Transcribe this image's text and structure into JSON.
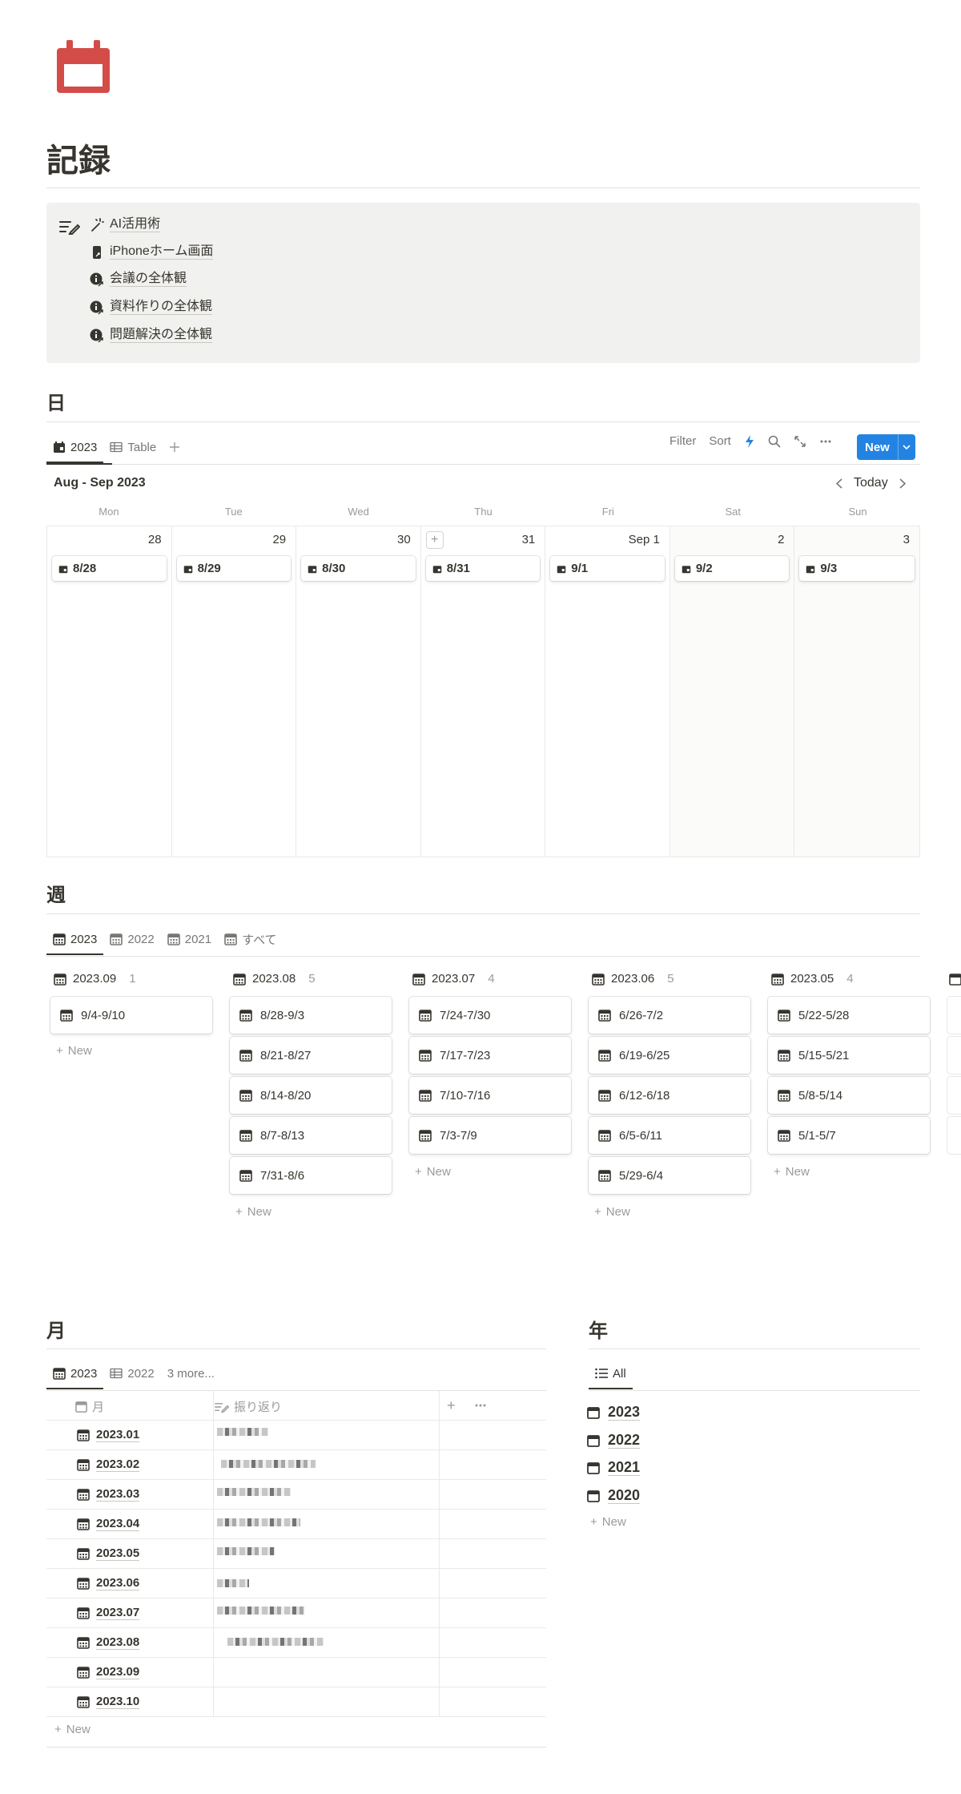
{
  "page": {
    "title": "記録",
    "icon": "calendar-icon",
    "icon_color": "#d44c47"
  },
  "callout": {
    "icon": "edit-list-icon",
    "items": [
      {
        "label": "AI活用術",
        "icon": "magic-wand-icon"
      },
      {
        "label": "iPhoneホーム画面",
        "icon": "phone-link-icon"
      },
      {
        "label": "会議の全体観",
        "icon": "info-link-icon"
      },
      {
        "label": "資料作りの全体観",
        "icon": "info-link-icon"
      },
      {
        "label": "問題解決の全体観",
        "icon": "info-link-icon"
      }
    ]
  },
  "day_section": {
    "heading": "日",
    "tabs": [
      {
        "label": "2023",
        "icon": "calendar-icon"
      },
      {
        "label": "Table",
        "icon": "table-icon"
      }
    ],
    "toolbar": {
      "filter": "Filter",
      "sort": "Sort",
      "new": "New"
    },
    "range_label": "Aug - Sep 2023",
    "today": "Today",
    "weekdays": [
      "Mon",
      "Tue",
      "Wed",
      "Thu",
      "Fri",
      "Sat",
      "Sun"
    ],
    "days": [
      {
        "num": "28",
        "card": "8/28"
      },
      {
        "num": "29",
        "card": "8/29"
      },
      {
        "num": "30",
        "card": "8/30"
      },
      {
        "num": "31",
        "card": "8/31"
      },
      {
        "num": "Sep 1",
        "card": "9/1"
      },
      {
        "num": "2",
        "card": "9/2"
      },
      {
        "num": "3",
        "card": "9/3"
      }
    ],
    "accent": "#2383e2"
  },
  "week_section": {
    "heading": "週",
    "tabs": [
      "2023",
      "2022",
      "2021",
      "すべて"
    ],
    "new_label": "New",
    "columns": [
      {
        "title": "2023.09",
        "count": "1",
        "cards": [
          "9/4-9/10"
        ]
      },
      {
        "title": "2023.08",
        "count": "5",
        "cards": [
          "8/28-9/3",
          "8/21-8/27",
          "8/14-8/20",
          "8/7-8/13",
          "7/31-8/6"
        ]
      },
      {
        "title": "2023.07",
        "count": "4",
        "cards": [
          "7/24-7/30",
          "7/17-7/23",
          "7/10-7/16",
          "7/3-7/9"
        ]
      },
      {
        "title": "2023.06",
        "count": "5",
        "cards": [
          "6/26-7/2",
          "6/19-6/25",
          "6/12-6/18",
          "6/5-6/11",
          "5/29-6/4"
        ]
      },
      {
        "title": "2023.05",
        "count": "4",
        "cards": [
          "5/22-5/28",
          "5/15-5/21",
          "5/8-5/14",
          "5/1-5/7"
        ]
      }
    ]
  },
  "month_section": {
    "heading": "月",
    "tabs": [
      "2023",
      "2022"
    ],
    "more_tabs": "3 more...",
    "col_name": "月",
    "col_review": "振り返り",
    "rows": [
      "2023.01",
      "2023.02",
      "2023.03",
      "2023.04",
      "2023.05",
      "2023.06",
      "2023.07",
      "2023.08",
      "2023.09",
      "2023.10"
    ],
    "new_label": "New"
  },
  "year_section": {
    "heading": "年",
    "tab": "All",
    "items": [
      "2023",
      "2022",
      "2021",
      "2020"
    ],
    "new_label": "New"
  }
}
